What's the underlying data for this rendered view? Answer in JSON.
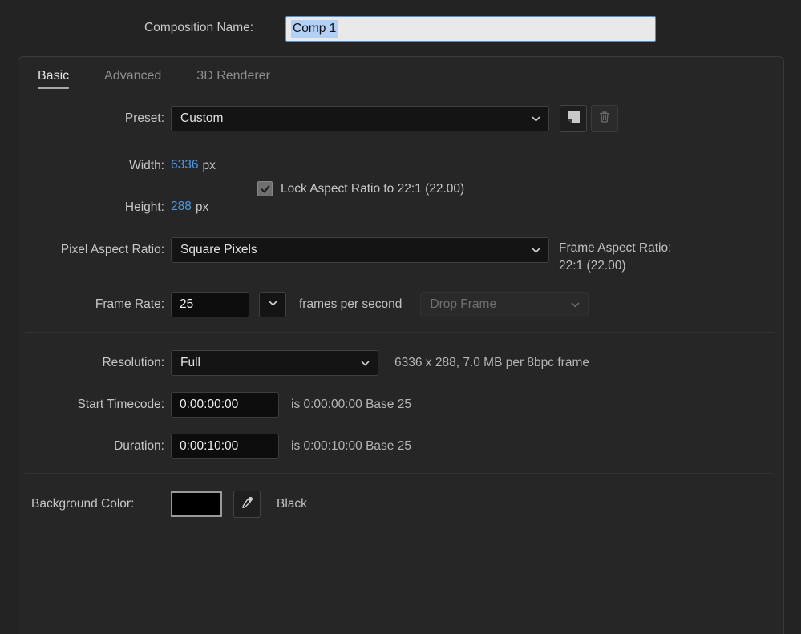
{
  "dialog": {
    "comp_name_label": "Composition Name:",
    "comp_name_value": "Comp 1"
  },
  "tabs": [
    {
      "label": "Basic",
      "active": true
    },
    {
      "label": "Advanced",
      "active": false
    },
    {
      "label": "3D Renderer",
      "active": false
    }
  ],
  "basic": {
    "preset": {
      "label": "Preset:",
      "value": "Custom",
      "save_icon": "save-preset-icon",
      "delete_icon": "trash-icon"
    },
    "width": {
      "label": "Width:",
      "value": "6336",
      "unit": "px"
    },
    "height": {
      "label": "Height:",
      "value": "288",
      "unit": "px"
    },
    "lock_aspect": {
      "label": "Lock Aspect Ratio to 22:1 (22.00)",
      "checked": true
    },
    "pixel_aspect_ratio": {
      "label": "Pixel Aspect Ratio:",
      "value": "Square Pixels"
    },
    "frame_aspect_ratio": {
      "label": "Frame Aspect Ratio:",
      "value": "22:1 (22.00)"
    },
    "frame_rate": {
      "label": "Frame Rate:",
      "value": "25",
      "unit_label": "frames per second",
      "drop_frame_value": "Drop Frame",
      "drop_frame_enabled": false
    },
    "resolution": {
      "label": "Resolution:",
      "value": "Full",
      "info": "6336 x 288, 7.0 MB per 8bpc frame"
    },
    "start_timecode": {
      "label": "Start Timecode:",
      "value": "0:00:00:00",
      "info": "is 0:00:00:00  Base 25"
    },
    "duration": {
      "label": "Duration:",
      "value": "0:00:10:00",
      "info": "is 0:00:10:00  Base 25"
    },
    "background_color": {
      "label": "Background Color:",
      "swatch_hex": "#000000",
      "eyedropper_icon": "eyedropper-icon",
      "name": "Black"
    }
  },
  "colors": {
    "accent_blue": "#4a9ae8",
    "panel_bg": "#262626",
    "window_bg": "#232323",
    "field_bg": "#141414",
    "selection_blue": "#b3d1f7"
  }
}
